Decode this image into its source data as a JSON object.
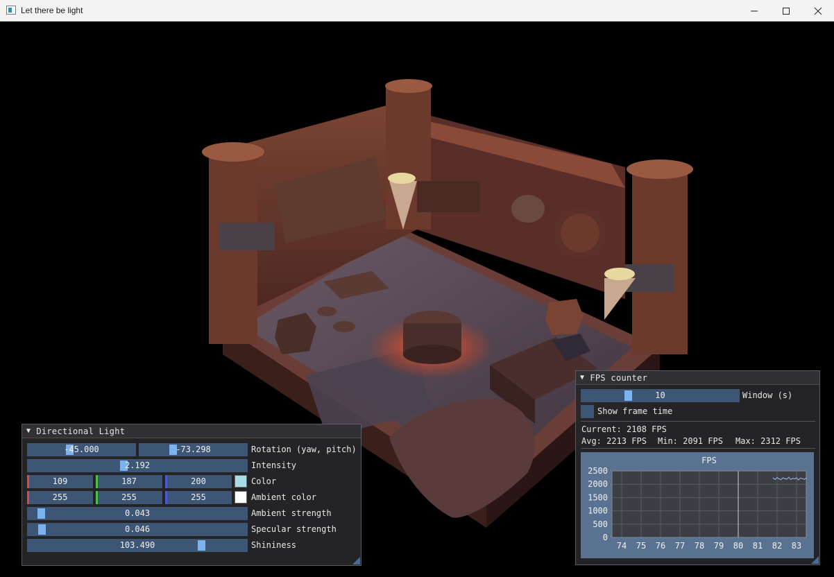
{
  "window": {
    "title": "Let there be light",
    "minimize_icon": "minimize-icon",
    "maximize_icon": "maximize-icon",
    "close_icon": "close-icon"
  },
  "directional_light": {
    "title": "Directional Light",
    "collapse_icon": "triangle-down-icon",
    "rotation": {
      "yaw": "-45.000",
      "pitch": "-73.298",
      "label": "Rotation (yaw, pitch)",
      "yaw_grab": 0.374,
      "pitch_grab": 0.312
    },
    "intensity": {
      "value": "2.192",
      "label": "Intensity",
      "grab": 0.438
    },
    "color": {
      "r": "109",
      "g": "187",
      "b": "200",
      "label": "Color",
      "swatch": "#A6DDE6"
    },
    "ambient_color": {
      "r": "255",
      "g": "255",
      "b": "255",
      "label": "Ambient color",
      "swatch": "#FFFFFF"
    },
    "ambient_strength": {
      "value": "0.043",
      "label": "Ambient strength",
      "grab": 0.043
    },
    "specular_strength": {
      "value": "0.046",
      "label": "Specular strength",
      "grab": 0.046
    },
    "shininess": {
      "value": "103.490",
      "label": "Shininess",
      "grab": 0.81
    }
  },
  "fps_counter": {
    "title": "FPS counter",
    "collapse_icon": "triangle-down-icon",
    "window": {
      "value": "10",
      "label": "Window (s)",
      "grab": 0.3
    },
    "show_frame_time": {
      "label": "Show frame time",
      "checked": false
    },
    "current": "Current: 2108 FPS",
    "avg": "Avg: 2213 FPS",
    "min": "Min: 2091 FPS",
    "max": "Max: 2312 FPS"
  },
  "chart_data": {
    "type": "line",
    "title": "FPS",
    "xlabel": "",
    "ylabel": "",
    "xlim": [
      73.5,
      83.5
    ],
    "ylim": [
      0,
      2500
    ],
    "x_ticks": [
      "74",
      "75",
      "76",
      "77",
      "78",
      "79",
      "80",
      "81",
      "82",
      "83"
    ],
    "y_ticks": [
      "2500",
      "2000",
      "1500",
      "1000",
      "500",
      "0"
    ],
    "grid": true,
    "marker_x": 80,
    "series": [
      {
        "x": [
          81.8,
          81.9,
          82.0,
          82.1,
          82.2,
          82.3,
          82.4,
          82.5,
          82.6,
          82.7,
          82.8,
          82.9,
          83.0,
          83.1,
          83.2,
          83.3,
          83.4,
          83.5
        ],
        "values": [
          2230,
          2180,
          2250,
          2200,
          2170,
          2240,
          2210,
          2190,
          2260,
          2180,
          2220,
          2200,
          2240,
          2160,
          2230,
          2210,
          2180,
          2240
        ]
      }
    ],
    "colors": {
      "line": "#9bb8e0",
      "background": "#5a7291",
      "frame": "#3d3d45"
    }
  }
}
